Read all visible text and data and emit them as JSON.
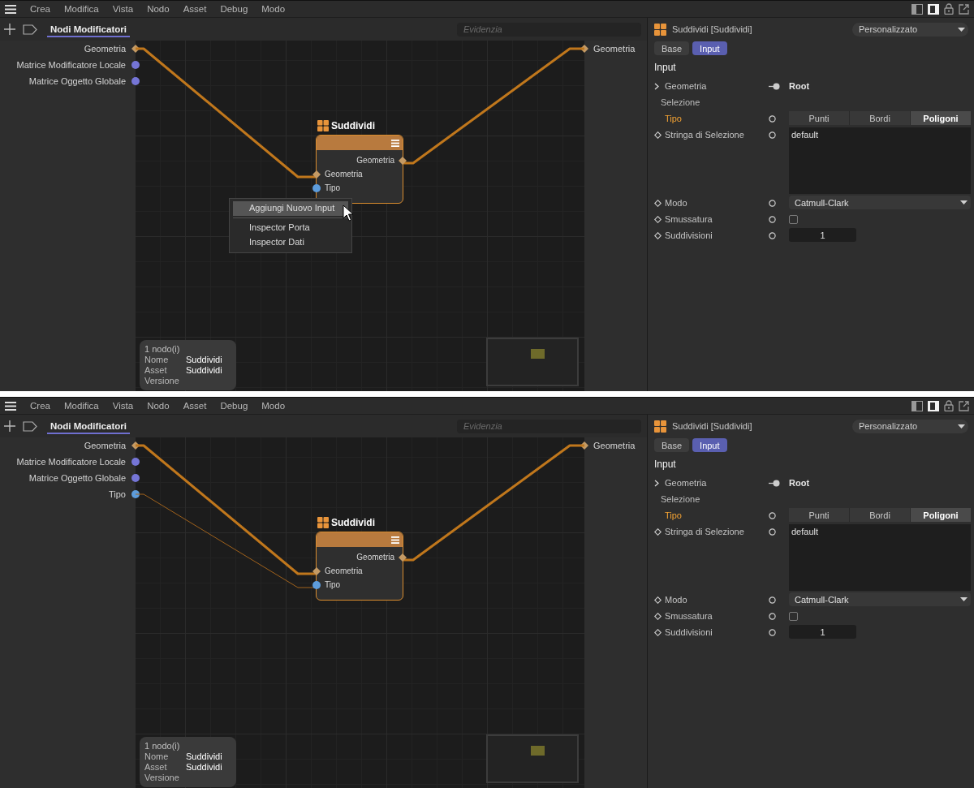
{
  "panels": [
    {
      "menu": [
        "Crea",
        "Modifica",
        "Vista",
        "Nodo",
        "Asset",
        "Debug",
        "Modo"
      ],
      "tab": {
        "label": "Nodi Modificatori",
        "selected": true
      },
      "search": {
        "placeholder": "Evidenzia"
      },
      "input_ports": [
        {
          "label": "Geometria",
          "kind": "geometry"
        },
        {
          "label": "Matrice Modificatore Locale",
          "kind": "matrix"
        },
        {
          "label": "Matrice Oggetto Globale",
          "kind": "matrix"
        }
      ],
      "output_ports": [
        {
          "label": "Geometria",
          "kind": "geometry"
        }
      ],
      "node": {
        "title": "Suddividi",
        "outputs": [
          {
            "label": "Geometria",
            "kind": "geometry"
          }
        ],
        "inputs": [
          {
            "label": "Geometria",
            "kind": "geometry"
          },
          {
            "label": "Tipo",
            "kind": "type"
          }
        ]
      },
      "context_menu": {
        "groups": [
          [
            {
              "label": "Aggiungi Nuovo Input",
              "selected": true
            }
          ],
          [
            {
              "label": "Inspector Porta",
              "selected": false
            },
            {
              "label": "Inspector Dati",
              "selected": false
            }
          ]
        ]
      },
      "info": {
        "count": "1 nodo(i)",
        "rows": [
          {
            "key": "Nome",
            "value": "Suddividi"
          },
          {
            "key": "Asset",
            "value": "Suddividi"
          },
          {
            "key": "Versione"
          }
        ]
      },
      "inspector": {
        "title": "Suddividi [Suddividi]",
        "preset": "Personalizzato",
        "tabs": [
          {
            "label": "Base",
            "selected": false
          },
          {
            "label": "Input",
            "selected": true
          }
        ],
        "section": "Input",
        "rows": [
          {
            "kind": "link",
            "label": "Geometria",
            "value": "Root"
          },
          {
            "kind": "group",
            "label": "Selezione"
          },
          {
            "kind": "segmented",
            "label": "Tipo",
            "highlighted": true,
            "options": [
              {
                "label": "Punti",
                "selected": false
              },
              {
                "label": "Bordi",
                "selected": false
              },
              {
                "label": "Poligoni",
                "selected": true
              }
            ]
          },
          {
            "kind": "text",
            "label": "Stringa di Selezione",
            "value": "default"
          },
          {
            "kind": "dropdown",
            "label": "Modo",
            "value": "Catmull-Clark"
          },
          {
            "kind": "checkbox",
            "label": "Smussatura",
            "checked": false
          },
          {
            "kind": "number",
            "label": "Suddivisioni",
            "value": "1"
          }
        ]
      }
    },
    {
      "menu": [
        "Crea",
        "Modifica",
        "Vista",
        "Nodo",
        "Asset",
        "Debug",
        "Modo"
      ],
      "tab": {
        "label": "Nodi Modificatori",
        "selected": true
      },
      "search": {
        "placeholder": "Evidenzia"
      },
      "input_ports": [
        {
          "label": "Geometria",
          "kind": "geometry"
        },
        {
          "label": "Matrice Modificatore Locale",
          "kind": "matrix"
        },
        {
          "label": "Matrice Oggetto Globale",
          "kind": "matrix"
        },
        {
          "label": "Tipo",
          "kind": "type"
        }
      ],
      "output_ports": [
        {
          "label": "Geometria",
          "kind": "geometry"
        }
      ],
      "node": {
        "title": "Suddividi",
        "outputs": [
          {
            "label": "Geometria",
            "kind": "geometry"
          }
        ],
        "inputs": [
          {
            "label": "Geometria",
            "kind": "geometry"
          },
          {
            "label": "Tipo",
            "kind": "type"
          }
        ]
      },
      "info": {
        "count": "1 nodo(i)",
        "rows": [
          {
            "key": "Nome",
            "value": "Suddividi"
          },
          {
            "key": "Asset",
            "value": "Suddividi"
          },
          {
            "key": "Versione"
          }
        ]
      },
      "inspector": {
        "title": "Suddividi [Suddividi]",
        "preset": "Personalizzato",
        "tabs": [
          {
            "label": "Base",
            "selected": false
          },
          {
            "label": "Input",
            "selected": true
          }
        ],
        "section": "Input",
        "rows": [
          {
            "kind": "link",
            "label": "Geometria",
            "value": "Root"
          },
          {
            "kind": "group",
            "label": "Selezione"
          },
          {
            "kind": "segmented",
            "label": "Tipo",
            "highlighted": true,
            "options": [
              {
                "label": "Punti",
                "selected": false
              },
              {
                "label": "Bordi",
                "selected": false
              },
              {
                "label": "Poligoni",
                "selected": true
              }
            ]
          },
          {
            "kind": "text",
            "label": "Stringa di Selezione",
            "value": "default"
          },
          {
            "kind": "dropdown",
            "label": "Modo",
            "value": "Catmull-Clark"
          },
          {
            "kind": "checkbox",
            "label": "Smussatura",
            "checked": false
          },
          {
            "kind": "number",
            "label": "Suddivisioni",
            "value": "1"
          }
        ]
      }
    }
  ]
}
